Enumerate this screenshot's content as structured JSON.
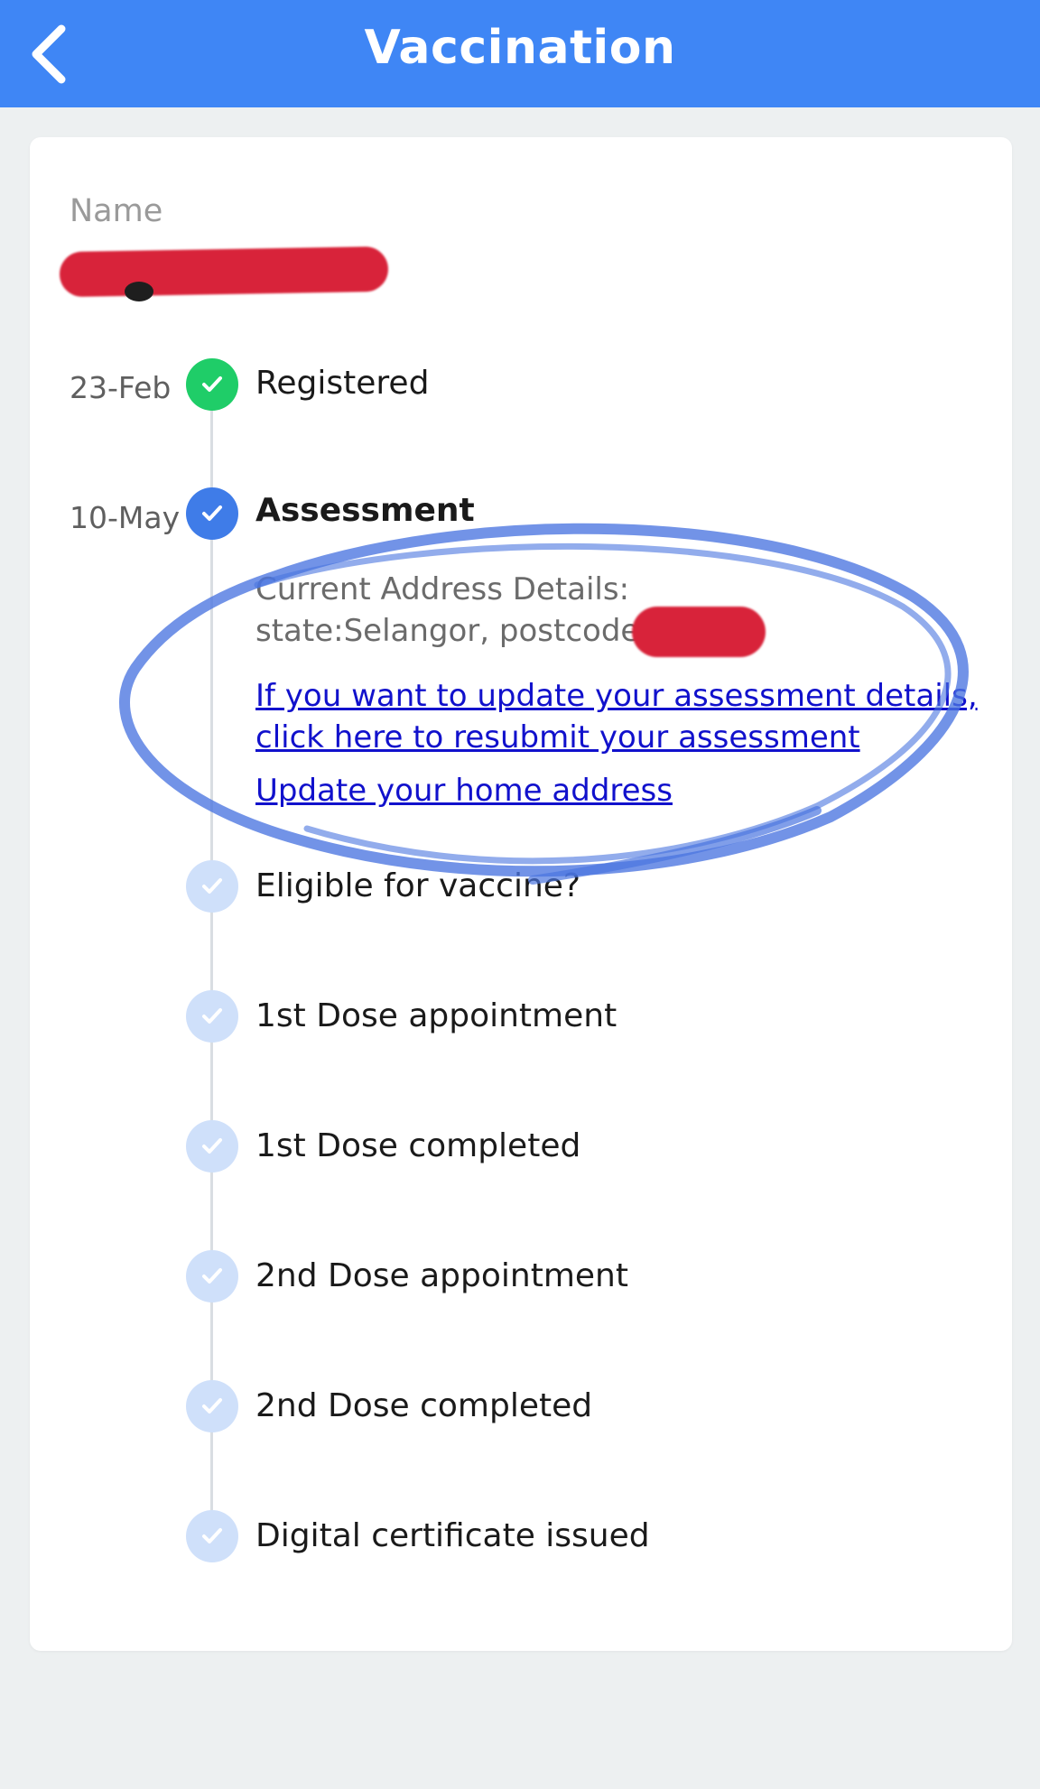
{
  "header": {
    "title": "Vaccination",
    "bar_color": "#3f86f5"
  },
  "profile": {
    "name_label": "Name",
    "name_value": "[redacted]"
  },
  "timeline": [
    {
      "date": "23-Feb",
      "label": "Registered",
      "status": "done",
      "icon_color": "#1fcd68"
    },
    {
      "date": "10-May",
      "label": "Assessment",
      "status": "current",
      "icon_color": "#3f7ce8"
    },
    {
      "date": "",
      "label": "Eligible for vaccine?",
      "status": "pending",
      "icon_color": "#cfe0fa"
    },
    {
      "date": "",
      "label": "1st Dose appointment",
      "status": "pending",
      "icon_color": "#cfe0fa"
    },
    {
      "date": "",
      "label": "1st Dose completed",
      "status": "pending",
      "icon_color": "#cfe0fa"
    },
    {
      "date": "",
      "label": "2nd Dose appointment",
      "status": "pending",
      "icon_color": "#cfe0fa"
    },
    {
      "date": "",
      "label": "2nd Dose completed",
      "status": "pending",
      "icon_color": "#cfe0fa"
    },
    {
      "date": "",
      "label": "Digital certificate issued",
      "status": "pending",
      "icon_color": "#cfe0fa"
    }
  ],
  "assessment": {
    "address_heading": "Current Address Details:",
    "address_line": "state:Selangor, postcode",
    "resubmit_link_line1": "If you want to update your assessment details,",
    "resubmit_link_line2": "click here to resubmit your assessment",
    "update_address_link": "Update your home address"
  },
  "icons": {
    "back": "chevron-left-icon",
    "step": "checkmark-icon"
  }
}
